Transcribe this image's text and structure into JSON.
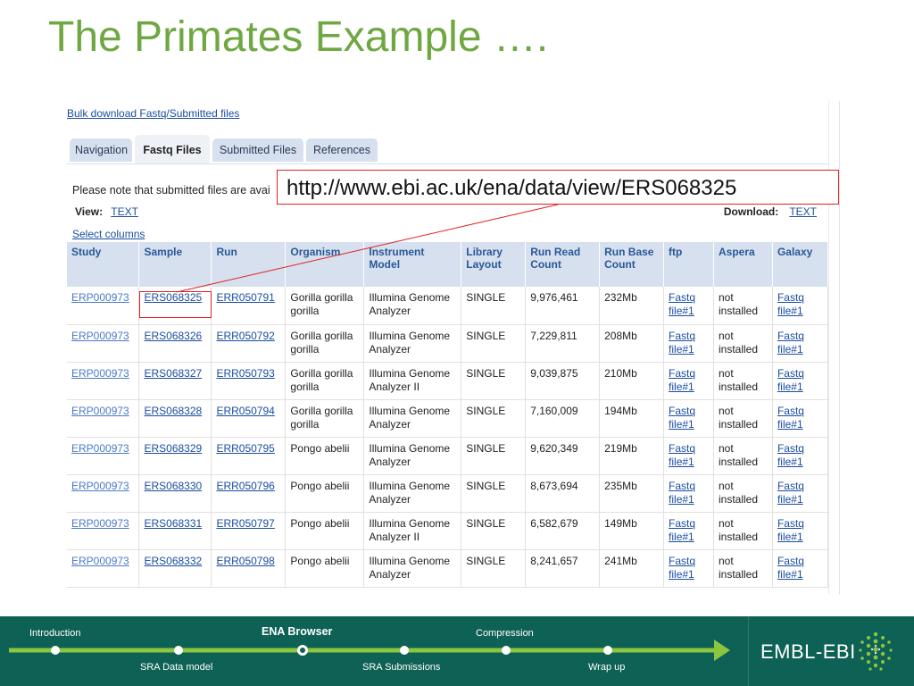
{
  "slide": {
    "title": "The Primates Example …."
  },
  "browser": {
    "bulk_link": "Bulk download Fastq/Submitted files",
    "tabs": [
      {
        "label": "Navigation",
        "active": false
      },
      {
        "label": "Fastq Files",
        "active": true
      },
      {
        "label": "Submitted Files",
        "active": false
      },
      {
        "label": "References",
        "active": false
      }
    ],
    "note": "Please note that submitted files are avai",
    "view_label": "View:",
    "view_link": "TEXT",
    "download_label": "Download:",
    "download_link": "TEXT",
    "select_columns": "Select columns",
    "columns": [
      "Study",
      "Sample",
      "Run",
      "Organism",
      "Instrument Model",
      "Library Layout",
      "Run Read Count",
      "Run Base Count",
      "ftp",
      "Aspera",
      "Galaxy"
    ],
    "rows": [
      {
        "study": "ERP000973",
        "sample": "ERS068325",
        "run": "ERR050791",
        "organism": "Gorilla gorilla gorilla",
        "instrument": "Illumina Genome Analyzer",
        "layout": "SINGLE",
        "read_count": "9,976,461",
        "base_count": "232Mb",
        "ftp": "Fastq file#1",
        "aspera": "not installed",
        "galaxy": "Fastq file#1"
      },
      {
        "study": "ERP000973",
        "sample": "ERS068326",
        "run": "ERR050792",
        "organism": "Gorilla gorilla gorilla",
        "instrument": "Illumina Genome Analyzer",
        "layout": "SINGLE",
        "read_count": "7,229,811",
        "base_count": "208Mb",
        "ftp": "Fastq file#1",
        "aspera": "not installed",
        "galaxy": "Fastq file#1"
      },
      {
        "study": "ERP000973",
        "sample": "ERS068327",
        "run": "ERR050793",
        "organism": "Gorilla gorilla gorilla",
        "instrument": "Illumina Genome Analyzer II",
        "layout": "SINGLE",
        "read_count": "9,039,875",
        "base_count": "210Mb",
        "ftp": "Fastq file#1",
        "aspera": "not installed",
        "galaxy": "Fastq file#1"
      },
      {
        "study": "ERP000973",
        "sample": "ERS068328",
        "run": "ERR050794",
        "organism": "Gorilla gorilla gorilla",
        "instrument": "Illumina Genome Analyzer",
        "layout": "SINGLE",
        "read_count": "7,160,009",
        "base_count": "194Mb",
        "ftp": "Fastq file#1",
        "aspera": "not installed",
        "galaxy": "Fastq file#1"
      },
      {
        "study": "ERP000973",
        "sample": "ERS068329",
        "run": "ERR050795",
        "organism": "Pongo abelii",
        "instrument": "Illumina Genome Analyzer",
        "layout": "SINGLE",
        "read_count": "9,620,349",
        "base_count": "219Mb",
        "ftp": "Fastq file#1",
        "aspera": "not installed",
        "galaxy": "Fastq file#1"
      },
      {
        "study": "ERP000973",
        "sample": "ERS068330",
        "run": "ERR050796",
        "organism": "Pongo abelii",
        "instrument": "Illumina Genome Analyzer",
        "layout": "SINGLE",
        "read_count": "8,673,694",
        "base_count": "235Mb",
        "ftp": "Fastq file#1",
        "aspera": "not installed",
        "galaxy": "Fastq file#1"
      },
      {
        "study": "ERP000973",
        "sample": "ERS068331",
        "run": "ERR050797",
        "organism": "Pongo abelii",
        "instrument": "Illumina Genome Analyzer II",
        "layout": "SINGLE",
        "read_count": "6,582,679",
        "base_count": "149Mb",
        "ftp": "Fastq file#1",
        "aspera": "not installed",
        "galaxy": "Fastq file#1"
      },
      {
        "study": "ERP000973",
        "sample": "ERS068332",
        "run": "ERR050798",
        "organism": "Pongo abelii",
        "instrument": "Illumina Genome Analyzer",
        "layout": "SINGLE",
        "read_count": "8,241,657",
        "base_count": "241Mb",
        "ftp": "Fastq file#1",
        "aspera": "not installed",
        "galaxy": "Fastq file#1"
      }
    ]
  },
  "callout": {
    "url": "http://www.ebi.ac.uk/ena/data/view/ERS068325"
  },
  "footer": {
    "steps_top": [
      "Introduction",
      "ENA Browser",
      "Compression"
    ],
    "steps_bottom": [
      "SRA Data model",
      "SRA Submissions",
      "Wrap up"
    ],
    "current_step": "ENA Browser",
    "logo_text": "EMBL-EBI"
  },
  "colors": {
    "title": "#6fa843",
    "footer_bg": "#0e6155",
    "progress_line": "#8cc63f",
    "highlight": "#e02020",
    "table_header_bg": "#d6e0ee",
    "link": "#1a4da0"
  }
}
